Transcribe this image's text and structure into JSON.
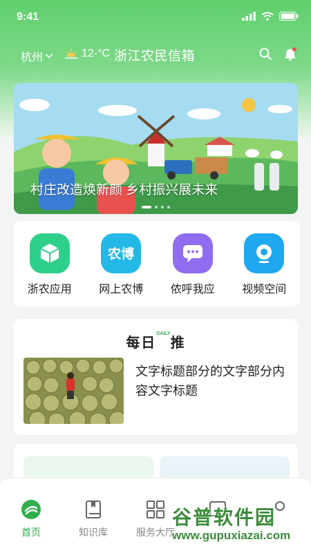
{
  "status": {
    "time": "9:41"
  },
  "topbar": {
    "city": "杭州",
    "weather": "12-°C",
    "title": "浙江农民信箱"
  },
  "banner": {
    "title": "村庄改造焕新颜 乡村振兴展未来",
    "slides": 4,
    "active_slide": 1
  },
  "apps": [
    {
      "label": "浙农应用",
      "icon": "cube-icon",
      "color": "#2ecf8a"
    },
    {
      "label": "网上农博",
      "icon": "nongbo-icon",
      "color": "#23b8e6"
    },
    {
      "label": "侬呼我应",
      "icon": "chat-icon",
      "color": "#8f6cf0"
    },
    {
      "label": "视频空间",
      "icon": "camera-icon",
      "color": "#1fa8f0"
    }
  ],
  "daily": {
    "title_left": "每日",
    "title_right": "推",
    "badge": "DAILY",
    "article_title": "文字标题部分的文字部分内容文字标题"
  },
  "tabs": [
    {
      "label": "首页"
    },
    {
      "label": "知识库"
    },
    {
      "label": "服务大厅"
    }
  ],
  "watermark": {
    "name": "谷普软件园",
    "url": "www.gupuxiazai.com"
  },
  "colors": {
    "primary": "#2fae4a",
    "header": "#5fcf6c"
  }
}
